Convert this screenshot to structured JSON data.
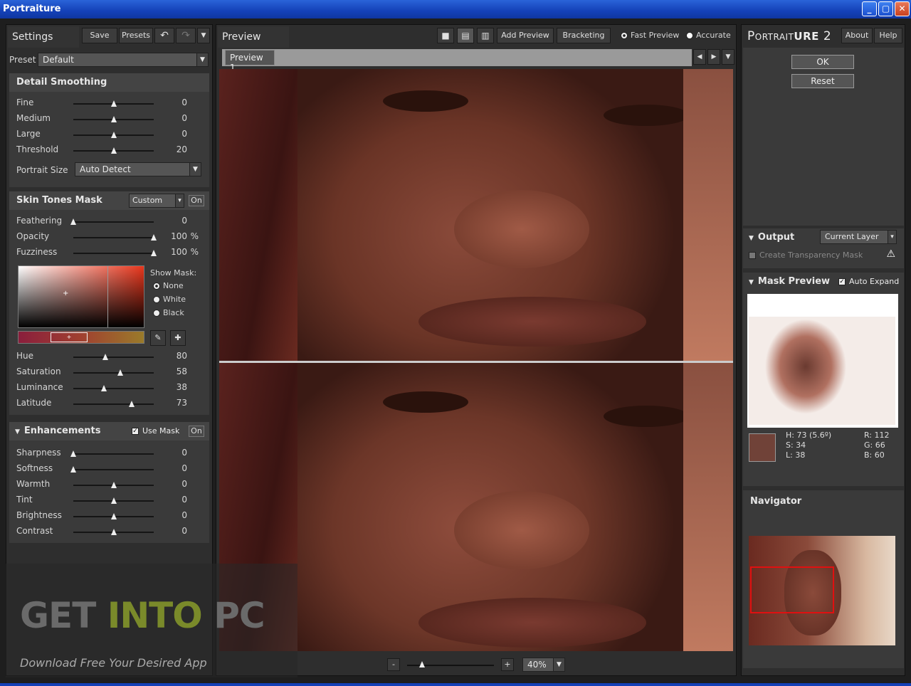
{
  "window": {
    "title": "Portraiture",
    "minimize": "_",
    "maximize": "▢",
    "close": "✕"
  },
  "left": {
    "title": "Settings",
    "save": "Save",
    "presets": "Presets",
    "undo_icon": "↶",
    "redo_icon": "↷",
    "menu_icon": "▼",
    "preset_label": "Preset",
    "preset_value": "Default",
    "detail": {
      "title": "Detail Smoothing",
      "rows": [
        {
          "label": "Fine",
          "value": "0",
          "level": 0.5
        },
        {
          "label": "Medium",
          "value": "0",
          "level": 0.5
        },
        {
          "label": "Large",
          "value": "0",
          "level": 0.5
        },
        {
          "label": "Threshold",
          "value": "20",
          "level": 0.5
        }
      ],
      "portrait_size_label": "Portrait Size",
      "portrait_size_value": "Auto Detect"
    },
    "skin": {
      "title": "Skin Tones Mask",
      "mode": "Custom",
      "on": "On",
      "rows": [
        {
          "label": "Feathering",
          "value": "0",
          "unit": "",
          "level": 0.0
        },
        {
          "label": "Opacity",
          "value": "100",
          "unit": "%",
          "level": 1.0
        },
        {
          "label": "Fuzziness",
          "value": "100",
          "unit": "%",
          "level": 1.0
        }
      ],
      "show_mask_label": "Show Mask:",
      "show_mask_options": [
        "None",
        "White",
        "Black"
      ],
      "show_mask_selected": "None",
      "hsl_rows": [
        {
          "label": "Hue",
          "value": "80",
          "level": 0.4
        },
        {
          "label": "Saturation",
          "value": "58",
          "level": 0.58
        },
        {
          "label": "Luminance",
          "value": "38",
          "level": 0.38
        },
        {
          "label": "Latitude",
          "value": "73",
          "level": 0.73
        }
      ]
    },
    "enh": {
      "title": "Enhancements",
      "use_mask": "Use Mask",
      "on": "On",
      "rows": [
        {
          "label": "Sharpness",
          "value": "0",
          "level": 0.0
        },
        {
          "label": "Softness",
          "value": "0",
          "level": 0.0
        },
        {
          "label": "Warmth",
          "value": "0",
          "level": 0.5
        },
        {
          "label": "Tint",
          "value": "0",
          "level": 0.5
        },
        {
          "label": "Brightness",
          "value": "0",
          "level": 0.5
        },
        {
          "label": "Contrast",
          "value": "0",
          "level": 0.5
        }
      ]
    }
  },
  "center": {
    "title": "Preview",
    "add_preview": "Add Preview",
    "bracketing": "Bracketing",
    "fast_preview": "Fast Preview",
    "accurate": "Accurate",
    "tab": "Preview 1",
    "zoom_minus": "-",
    "zoom_plus": "+",
    "zoom_value": "40%",
    "zoom_level": 0.17
  },
  "right": {
    "brand_a": "Portrait",
    "brand_b": "ure",
    "brand_num": "2",
    "about": "About",
    "help": "Help",
    "ok": "OK",
    "reset": "Reset",
    "output_label": "Output",
    "output_value": "Current Layer",
    "transparency": "Create Transparency Mask",
    "warning_icon": "⚠",
    "mask_preview": "Mask Preview",
    "auto_expand": "Auto Expand",
    "hsl": {
      "h": "H: 73 (5.6º)",
      "s": "S: 34",
      "l": "L: 38"
    },
    "rgb": {
      "r": "R: 112",
      "g": "G: 66",
      "b": "B: 60"
    },
    "swatch": "#704238",
    "navigator": "Navigator"
  },
  "watermark": {
    "get": "GET",
    "into": "INTO",
    "pc": "PC",
    "tagline": "Download Free Your Desired App"
  }
}
